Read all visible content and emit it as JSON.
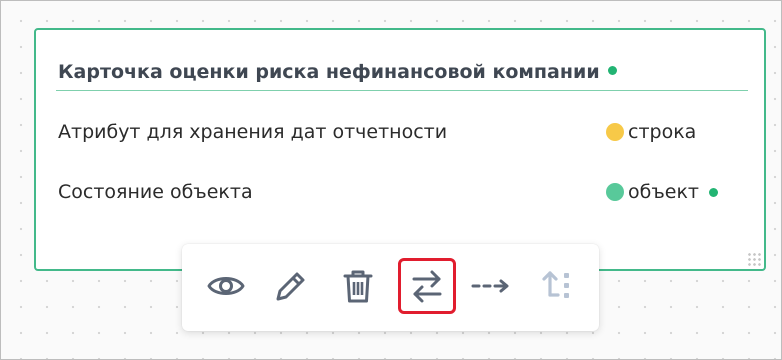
{
  "card": {
    "title": "Карточка оценки риска нефинансовой компании",
    "attributes": [
      {
        "name": "Атрибут для хранения дат отчетности",
        "type": "строка",
        "type_color": "#f7c948",
        "linked": false
      },
      {
        "name": "Состояние объекта",
        "type": "объект",
        "type_color": "#58c99a",
        "linked": true
      }
    ]
  },
  "toolbar": {
    "buttons": [
      {
        "id": "view",
        "icon": "eye-icon"
      },
      {
        "id": "edit",
        "icon": "pencil-icon"
      },
      {
        "id": "delete",
        "icon": "trash-icon"
      },
      {
        "id": "swap",
        "icon": "swap-arrows-icon",
        "highlighted": true
      },
      {
        "id": "link",
        "icon": "dashed-arrow-icon"
      },
      {
        "id": "reorder",
        "icon": "arrow-up-dots-icon",
        "disabled": true
      }
    ]
  },
  "colors": {
    "card_border": "#43b98a",
    "status_green": "#22b473",
    "icon": "#5b6575",
    "icon_disabled": "#b7c3d4",
    "highlight": "#e11d2e"
  }
}
